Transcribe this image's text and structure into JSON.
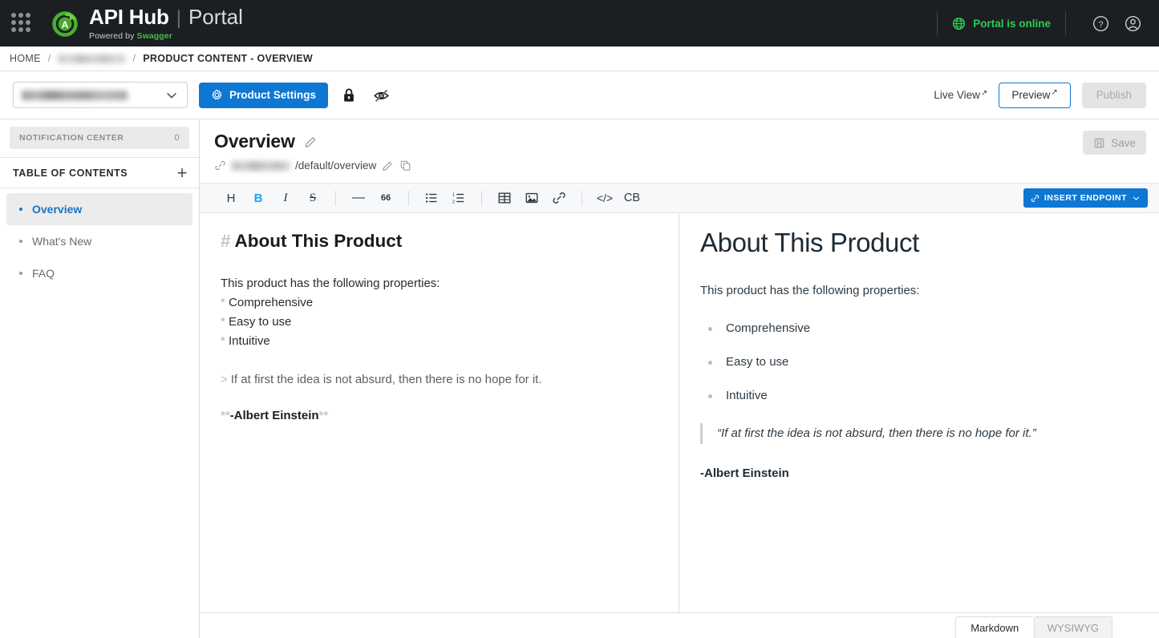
{
  "topnav": {
    "apps_label": "apps-grid",
    "brand": {
      "api": "API Hub",
      "separator": "|",
      "portal": "Portal",
      "powered_prefix": "Powered by ",
      "powered_brand": "Swagger"
    },
    "status": "Portal is online",
    "help_label": "help",
    "account_label": "account",
    "colors": {
      "bar_bg": "#1b1f22",
      "online_green": "#2ecc56",
      "logo_green": "#4caf2f"
    }
  },
  "breadcrumb": {
    "home": "HOME",
    "separator": "/",
    "redacted": "",
    "current": "PRODUCT CONTENT - OVERVIEW"
  },
  "actionbar": {
    "product_select_value": "",
    "product_settings": "Product Settings",
    "lock_label": "lock",
    "hidden_label": "hidden",
    "live_view": "Live View",
    "external_arrow": "↗",
    "preview": "Preview",
    "publish": "Publish",
    "primary_color": "#0d77d3"
  },
  "sidebar": {
    "notification_center": {
      "label": "NOTIFICATION CENTER",
      "count": "0"
    },
    "toc_title": "TABLE OF CONTENTS",
    "add_label": "+",
    "items": [
      {
        "label": "Overview",
        "active": true
      },
      {
        "label": "What's New",
        "active": false
      },
      {
        "label": "FAQ",
        "active": false
      }
    ]
  },
  "page": {
    "title": "Overview",
    "edit_title_label": "edit-title",
    "url_prefix_redacted": "",
    "url_path": "/default/overview",
    "edit_url_label": "edit-url",
    "copy_url_label": "copy-url",
    "save": "Save"
  },
  "editor_toolbar": {
    "buttons": [
      {
        "name": "heading",
        "glyph": "H"
      },
      {
        "name": "bold",
        "glyph": "B"
      },
      {
        "name": "italic",
        "glyph": "I"
      },
      {
        "name": "strikethrough",
        "glyph": "S"
      },
      {
        "name": "horizontal-rule",
        "glyph": "—"
      },
      {
        "name": "blockquote",
        "glyph": "66"
      },
      {
        "name": "bulleted-list",
        "glyph": ""
      },
      {
        "name": "numbered-list",
        "glyph": ""
      },
      {
        "name": "table",
        "glyph": ""
      },
      {
        "name": "image",
        "glyph": ""
      },
      {
        "name": "link",
        "glyph": ""
      },
      {
        "name": "inline-code",
        "glyph": "</>"
      },
      {
        "name": "code-block",
        "glyph": "CB"
      }
    ],
    "insert_endpoint": "INSERT ENDPOINT"
  },
  "markdown_source": {
    "heading_marker": "#",
    "heading_text": "About This Product",
    "intro": "This product has the following properties:",
    "bullet_marker": "*",
    "bullets": [
      "Comprehensive",
      "Easy to use",
      "Intuitive"
    ],
    "quote_marker": ">",
    "quote_text": "If at first the idea is not absurd, then there is no hope for it.",
    "bold_marker": "**",
    "signature": "-Albert Einstein"
  },
  "preview": {
    "heading": "About This Product",
    "intro": "This product has the following properties:",
    "bullets": [
      "Comprehensive",
      "Easy to use",
      "Intuitive"
    ],
    "quote": "“If at first the idea is not absurd, then there is no hope for it.”",
    "signature": "-Albert Einstein"
  },
  "footer_tabs": {
    "markdown": "Markdown",
    "wysiwyg": "WYSIWYG"
  }
}
